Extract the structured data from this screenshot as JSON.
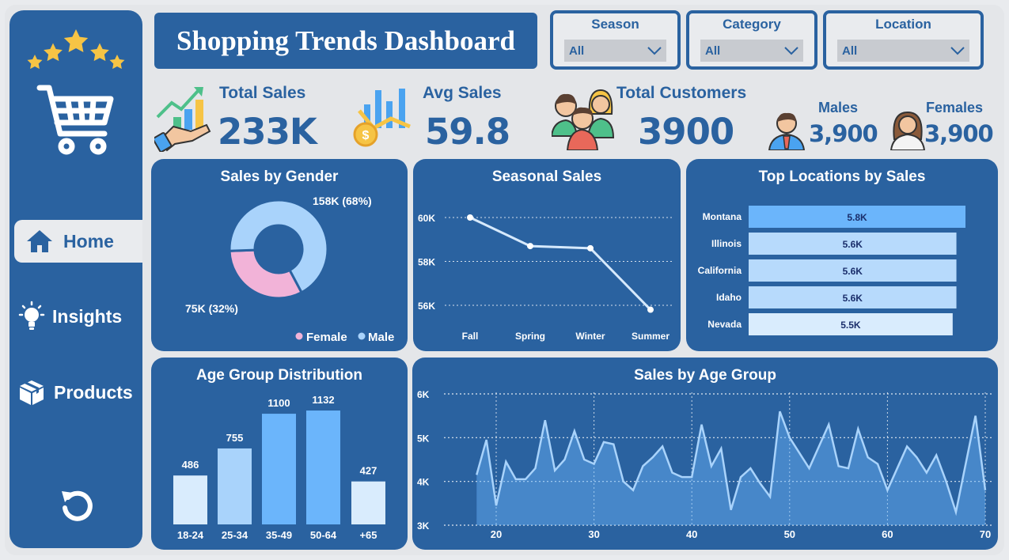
{
  "header": {
    "title": "Shopping Trends Dashboard"
  },
  "filters": [
    {
      "label": "Season",
      "value": "All"
    },
    {
      "label": "Category",
      "value": "All"
    },
    {
      "label": "Location",
      "value": "All"
    }
  ],
  "sidebar": {
    "items": [
      {
        "label": "Home",
        "icon": "home-icon",
        "active": true
      },
      {
        "label": "Insights",
        "icon": "lightbulb-icon",
        "active": false
      },
      {
        "label": "Products",
        "icon": "box-icon",
        "active": false
      }
    ],
    "logo_icon": "shopping-cart-icon",
    "reset_icon": "refresh-icon"
  },
  "kpis": {
    "total_sales": {
      "label": "Total Sales",
      "value": "233K"
    },
    "avg_sales": {
      "label": "Avg Sales",
      "value": "59.8"
    },
    "total_customers": {
      "label": "Total Customers",
      "value": "3900"
    },
    "males": {
      "label": "Males",
      "value": "3,900"
    },
    "females": {
      "label": "Females",
      "value": "3,900"
    }
  },
  "colors": {
    "panel": "#2a62a0",
    "female": "#f2b3d8",
    "male": "#a9d3fb",
    "accent": "#6bb5fb"
  },
  "chart_data": [
    {
      "type": "pie",
      "title": "Sales by Gender",
      "categories": [
        "Female",
        "Male"
      ],
      "values": [
        75,
        158
      ],
      "data_labels": [
        "75K (32%)",
        "158K (68%)"
      ],
      "legend": "bottom-right"
    },
    {
      "type": "line",
      "title": "Seasonal Sales",
      "categories": [
        "Fall",
        "Spring",
        "Winter",
        "Summer"
      ],
      "values": [
        60000,
        58700,
        58600,
        55800
      ],
      "yticks": [
        "60K",
        "58K",
        "56K"
      ],
      "ylim": [
        55000,
        61000
      ],
      "grid": true
    },
    {
      "type": "bar",
      "title": "Top Locations by Sales",
      "orientation": "horizontal",
      "categories": [
        "Montana",
        "Illinois",
        "California",
        "Idaho",
        "Nevada"
      ],
      "values": [
        5800,
        5600,
        5600,
        5600,
        5500
      ],
      "data_labels": [
        "5.8K",
        "5.6K",
        "5.6K",
        "5.6K",
        "5.5K"
      ]
    },
    {
      "type": "bar",
      "title": "Age Group Distribution",
      "categories": [
        "18-24",
        "25-34",
        "35-49",
        "50-64",
        "+65"
      ],
      "values": [
        486,
        755,
        1100,
        1132,
        427
      ]
    },
    {
      "type": "area",
      "title": "Sales by Age Group",
      "x": [
        18,
        19,
        20,
        21,
        22,
        23,
        24,
        25,
        26,
        27,
        28,
        29,
        30,
        31,
        32,
        33,
        34,
        35,
        36,
        37,
        38,
        39,
        40,
        41,
        42,
        43,
        44,
        45,
        46,
        47,
        48,
        49,
        50,
        51,
        52,
        53,
        54,
        55,
        56,
        57,
        58,
        59,
        60,
        61,
        62,
        63,
        64,
        65,
        66,
        67,
        68,
        69,
        70
      ],
      "values": [
        4150,
        4950,
        3450,
        4450,
        4050,
        4050,
        4300,
        5400,
        4250,
        4500,
        5150,
        4500,
        4400,
        4900,
        4850,
        4000,
        3800,
        4350,
        4550,
        4800,
        4200,
        4100,
        4100,
        5300,
        4350,
        4750,
        3350,
        4100,
        4300,
        3950,
        3650,
        5600,
        5000,
        4650,
        4300,
        4800,
        5300,
        4350,
        4300,
        5200,
        4550,
        4400,
        3800,
        4300,
        4800,
        4550,
        4200,
        4600,
        4000,
        3300,
        4400,
        5500,
        3800
      ],
      "xticks": [
        20,
        30,
        40,
        50,
        60,
        70
      ],
      "yticks": [
        "6K",
        "5K",
        "4K",
        "3K"
      ],
      "ylim": [
        3000,
        6000
      ],
      "grid": true
    }
  ]
}
